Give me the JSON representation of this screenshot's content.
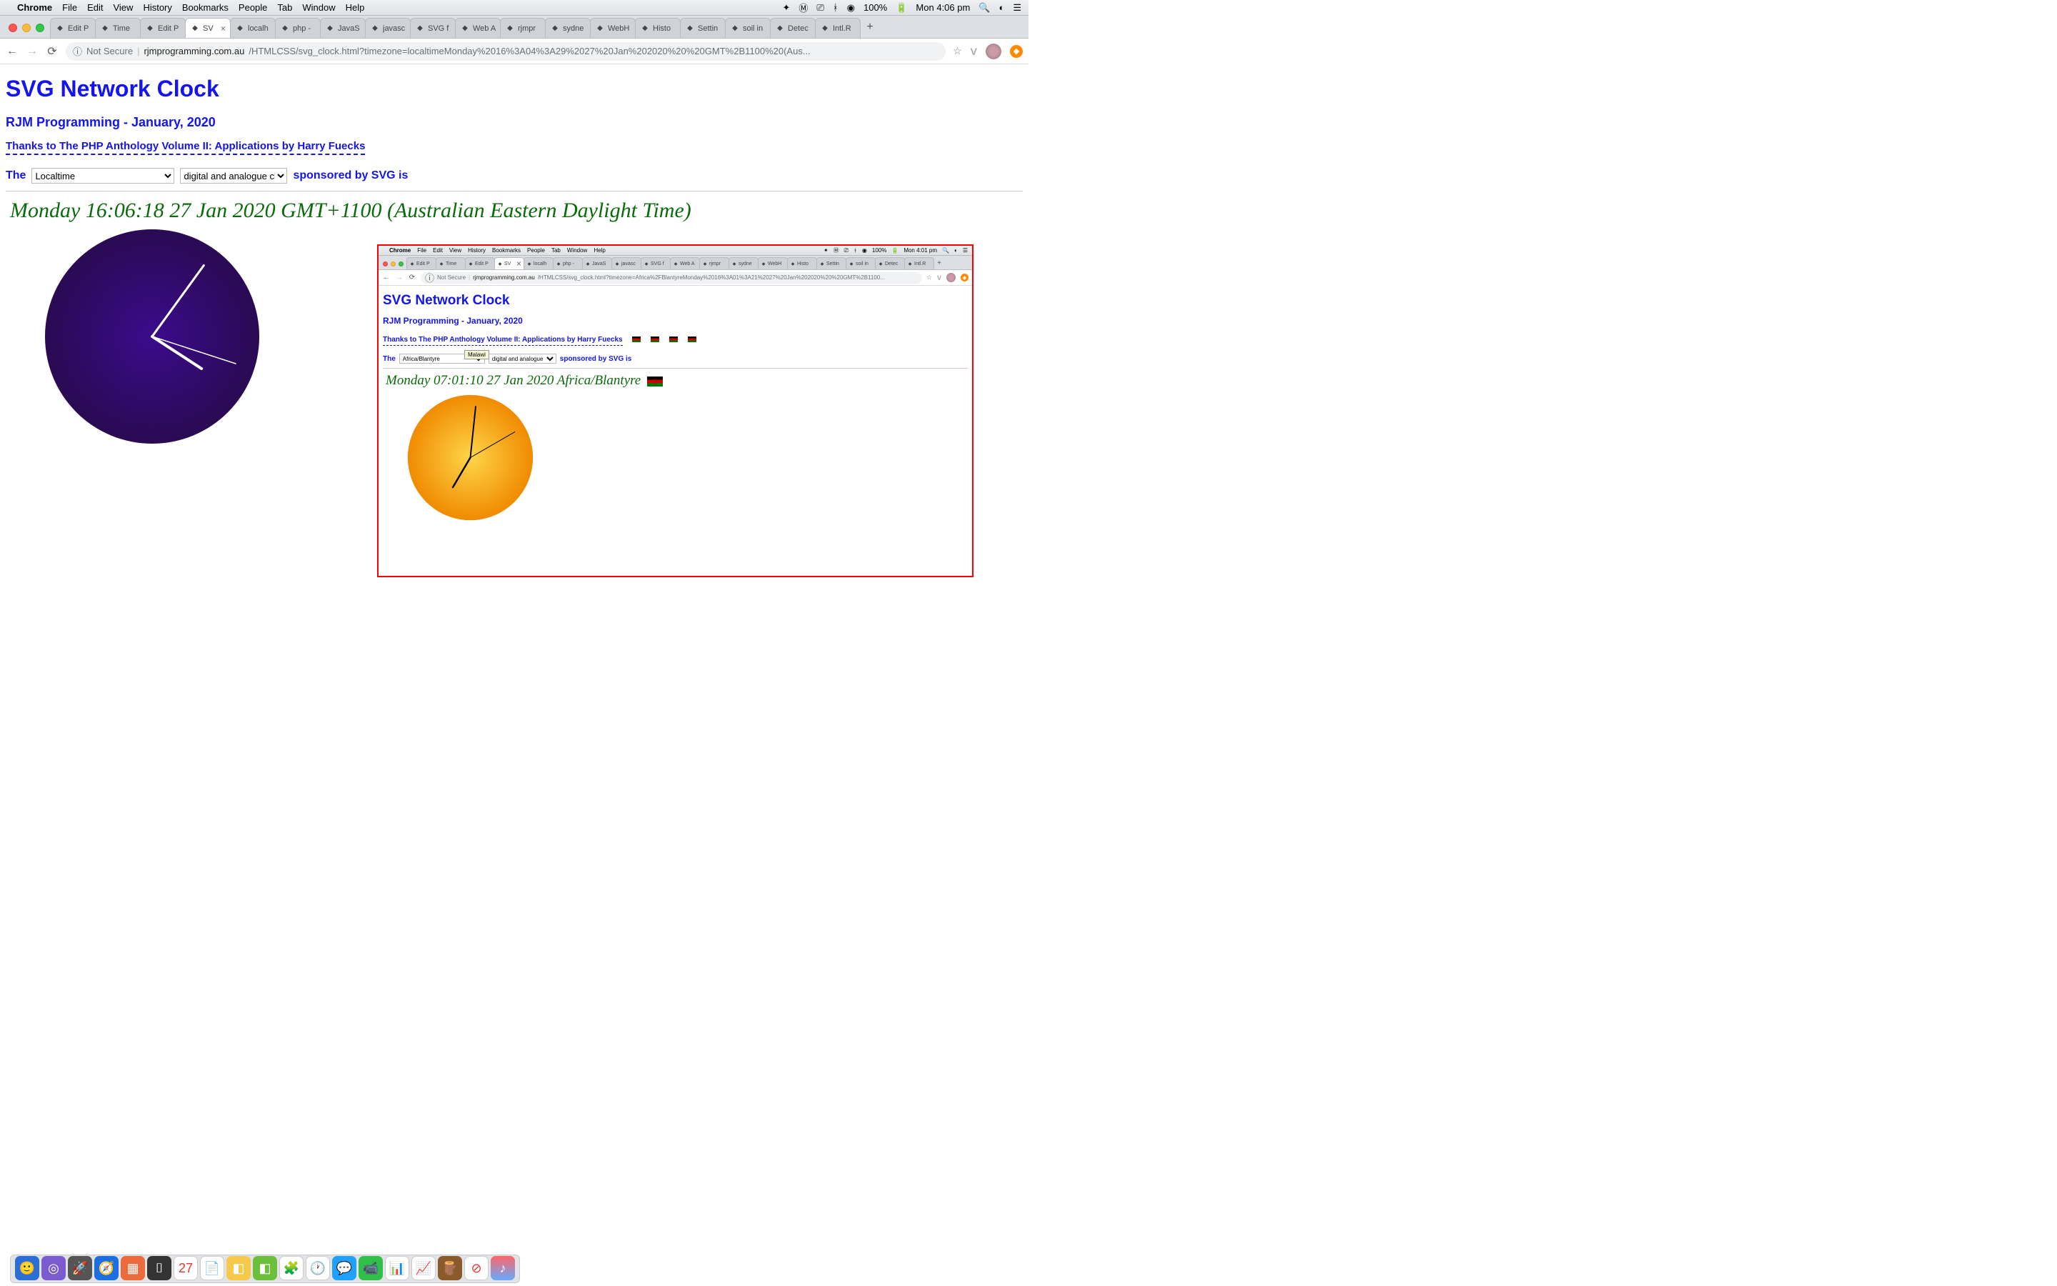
{
  "menubar": {
    "app": "Chrome",
    "items": [
      "File",
      "Edit",
      "View",
      "History",
      "Bookmarks",
      "People",
      "Tab",
      "Window",
      "Help"
    ],
    "battery": "100%",
    "clock": "Mon 4:06 pm"
  },
  "tabs": [
    {
      "label": "Edit P"
    },
    {
      "label": "Time"
    },
    {
      "label": "Edit P"
    },
    {
      "label": "SV",
      "active": true
    },
    {
      "label": "localh"
    },
    {
      "label": "php -"
    },
    {
      "label": "JavaS"
    },
    {
      "label": "javasc"
    },
    {
      "label": "SVG f"
    },
    {
      "label": "Web A"
    },
    {
      "label": "rjmpr"
    },
    {
      "label": "sydne"
    },
    {
      "label": "WebH"
    },
    {
      "label": "Histo"
    },
    {
      "label": "Settin"
    },
    {
      "label": "soil in"
    },
    {
      "label": "Detec"
    },
    {
      "label": "Intl.R"
    }
  ],
  "addr": {
    "not_secure": "Not Secure",
    "host": "rjmprogramming.com.au",
    "rest": "/HTMLCSS/svg_clock.html?timezone=localtimeMonday%2016%3A04%3A29%2027%20Jan%202020%20%20GMT%2B1100%20(Aus..."
  },
  "page": {
    "title": "SVG Network Clock",
    "subtitle": "RJM Programming - January, 2020",
    "thanks": "Thanks to The PHP Anthology Volume II: Applications by Harry Fuecks",
    "ctrl_the": "The",
    "tz_value": "Localtime",
    "mode_value": "digital and analogue clock",
    "ctrl_sponsored": "sponsored by SVG is",
    "datetime": "Monday 16:06:18 27 Jan 2020 GMT+1100 (Australian Eastern Daylight Time)"
  },
  "chart_data": {
    "type": "clock",
    "outer": {
      "hours": 4,
      "minutes": 6,
      "seconds": 18,
      "face_color_center": "#3b0b8c",
      "face_color_edge": "#2a0a52",
      "hand_color": "#ffffff",
      "radius": 150
    },
    "inner": {
      "hours": 7,
      "minutes": 1,
      "seconds": 10,
      "face_color_center": "#ffd54a",
      "face_color_edge": "#f08b00",
      "hand_color": "#000000",
      "radius": 90
    }
  },
  "nested": {
    "menubar_clock": "Mon 4:01 pm",
    "battery": "100%",
    "addr_rest": "/HTMLCSS/svg_clock.html?timezone=Africa%2FBlantyreMonday%2016%3A01%3A21%2027%20Jan%202020%20%20GMT%2B1100...",
    "tz_value": "Africa/Blantyre",
    "tooltip": "Malawi",
    "datetime": "Monday 07:01:10 27 Jan 2020 Africa/Blantyre"
  }
}
